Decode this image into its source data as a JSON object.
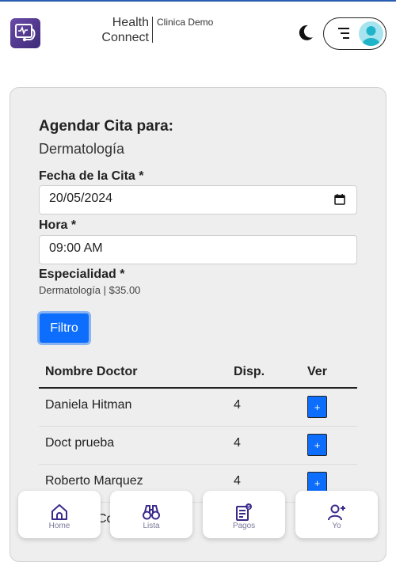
{
  "header": {
    "brand_line1": "Health",
    "brand_line2": "Connect",
    "clinic_name": "Clinica Demo"
  },
  "form": {
    "title": "Agendar Cita para:",
    "specialty_name": "Dermatología",
    "date_label": "Fecha de la Cita *",
    "date_value": "20/05/2024",
    "time_label": "Hora *",
    "time_value": "09:00 AM",
    "specialty_label": "Especialidad *",
    "specialty_value": "Dermatología | $35.00",
    "filter_button": "Filtro"
  },
  "table": {
    "headers": [
      "Nombre Doctor",
      "Disp.",
      "Ver"
    ],
    "rows": [
      {
        "doctor": "Daniela Hitman",
        "availability": "4",
        "action": "+"
      },
      {
        "doctor": "Doct prueba",
        "availability": "4",
        "action": "+"
      },
      {
        "doctor": "Roberto Marquez",
        "availability": "4",
        "action": "+"
      }
    ],
    "partial_row_text": "Co"
  },
  "bottom_nav": [
    {
      "label": "Home",
      "icon": "home-icon"
    },
    {
      "label": "Lista",
      "icon": "binoculars-icon"
    },
    {
      "label": "Pagos",
      "icon": "receipt-icon"
    },
    {
      "label": "Yo",
      "icon": "user-add-icon"
    }
  ],
  "colors": {
    "primary": "#0d6efd",
    "logo": "#4b3590",
    "nav_icon": "#3a2a8c",
    "avatar": "#a7e4ef"
  }
}
